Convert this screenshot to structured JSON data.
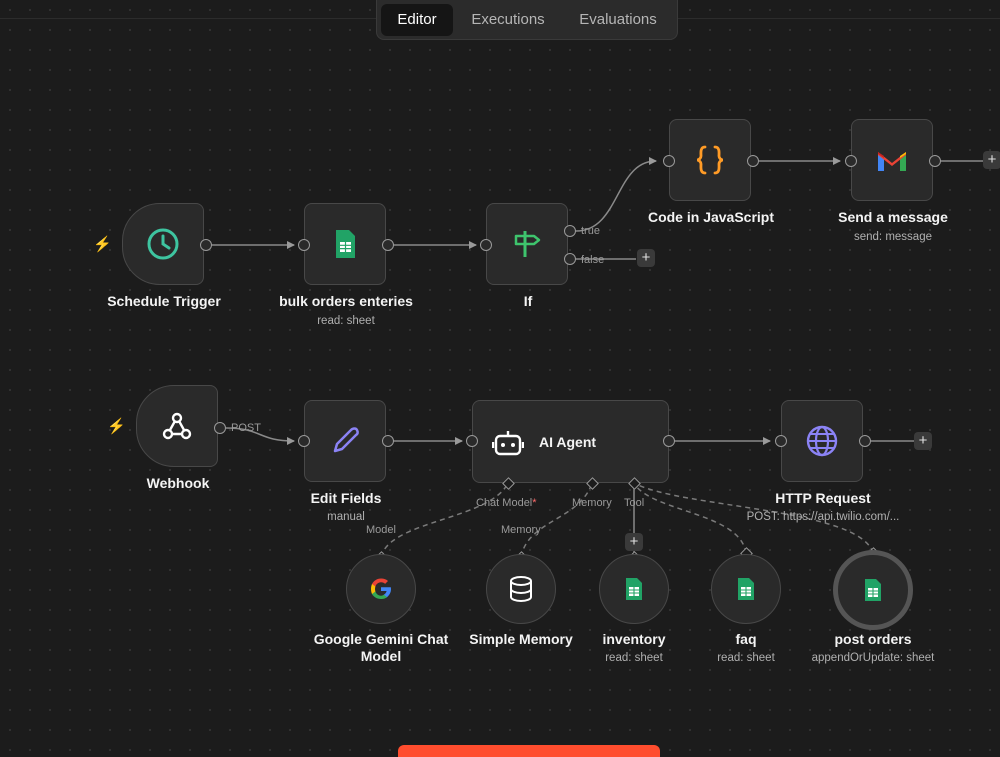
{
  "tabs": [
    {
      "label": "Editor",
      "active": true
    },
    {
      "label": "Executions",
      "active": false
    },
    {
      "label": "Evaluations",
      "active": false
    }
  ],
  "nodes": {
    "schedule_trigger": {
      "title": "Schedule Trigger",
      "icon": "clock-icon"
    },
    "bulk_orders": {
      "title": "bulk orders enteries",
      "subtitle": "read: sheet",
      "icon": "google-sheets-icon"
    },
    "if_node": {
      "title": "If",
      "icon": "signpost-icon",
      "true_label": "true",
      "false_label": "false"
    },
    "code_js": {
      "title": "Code in JavaScript",
      "icon": "curly-braces-icon"
    },
    "send_message": {
      "title": "Send a message",
      "subtitle": "send: message",
      "icon": "gmail-icon"
    },
    "webhook": {
      "title": "Webhook",
      "method_label": "POST",
      "icon": "webhook-icon"
    },
    "edit_fields": {
      "title": "Edit Fields",
      "subtitle": "manual",
      "icon": "pencil-icon"
    },
    "ai_agent": {
      "title": "AI Agent",
      "icon": "robot-icon"
    },
    "http_request": {
      "title": "HTTP Request",
      "subtitle": "POST: https://api.twilio.com/...",
      "icon": "globe-icon"
    },
    "gemini": {
      "title": "Google Gemini Chat Model",
      "icon": "google-icon"
    },
    "simple_memory": {
      "title": "Simple Memory",
      "icon": "database-icon"
    },
    "inventory": {
      "title": "inventory",
      "subtitle": "read: sheet",
      "icon": "google-sheets-icon"
    },
    "faq": {
      "title": "faq",
      "subtitle": "read: sheet",
      "icon": "google-sheets-icon"
    },
    "post_orders": {
      "title": "post orders",
      "subtitle": "appendOrUpdate: sheet",
      "icon": "google-sheets-icon"
    }
  },
  "agent_ports": {
    "chat_model": "Chat Model",
    "chat_model_required": "*",
    "memory": "Memory",
    "tool": "Tool"
  },
  "sub_ports": {
    "model": "Model",
    "memory": "Memory"
  },
  "colors": {
    "canvas": "#1c1c1c",
    "node_bg": "#2a2a2a",
    "trigger_bolt": "#ff6a5a",
    "sheets_green": "#21a366",
    "code_orange": "#ff9b26",
    "if_green": "#3ec46d",
    "pencil_purple": "#8b83f5",
    "globe_purple": "#8b83f5"
  }
}
